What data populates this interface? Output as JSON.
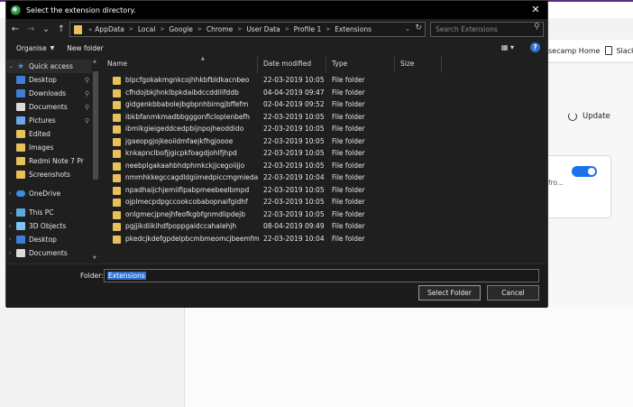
{
  "background": {
    "bookmarks": [
      {
        "label": "secamp Home"
      },
      {
        "label": "Slackb"
      }
    ],
    "update_label": "Update",
    "card_text": "fro...",
    "colors": {
      "accent": "#1a73e8",
      "window_edge": "#5a2d82"
    }
  },
  "dialog": {
    "title": "Select the extension directory.",
    "close_glyph": "✕",
    "nav": {
      "back": "←",
      "forward": "→",
      "recent": "⌄",
      "up": "↑"
    },
    "breadcrumb": [
      "AppData",
      "Local",
      "Google",
      "Chrome",
      "User Data",
      "Profile 1",
      "Extensions"
    ],
    "breadcrumb_prefix": "«",
    "search_placeholder": "Search Extensions",
    "toolbar": {
      "organise": "Organise",
      "new_folder": "New folder",
      "view_icon": "view-options-icon",
      "help": "?"
    },
    "nav_pane": [
      {
        "label": "Quick access",
        "icon": "star-icon",
        "selected": true
      },
      {
        "label": "Desktop",
        "icon": "desktop-icon",
        "pinned": true
      },
      {
        "label": "Downloads",
        "icon": "downloads-icon",
        "pinned": true
      },
      {
        "label": "Documents",
        "icon": "documents-icon",
        "pinned": true
      },
      {
        "label": "Pictures",
        "icon": "pictures-icon",
        "pinned": true
      },
      {
        "label": "Edited",
        "icon": "folder-icon"
      },
      {
        "label": "Images",
        "icon": "folder-icon"
      },
      {
        "label": "Redmi Note 7 Pr",
        "icon": "folder-icon"
      },
      {
        "label": "Screenshots",
        "icon": "folder-icon"
      },
      {
        "label": "OneDrive",
        "icon": "onedrive-icon"
      },
      {
        "label": "This PC",
        "icon": "pc-icon"
      },
      {
        "label": "3D Objects",
        "icon": "3d-objects-icon"
      },
      {
        "label": "Desktop",
        "icon": "desktop-icon"
      },
      {
        "label": "Documents",
        "icon": "documents-icon"
      }
    ],
    "columns": [
      "Name",
      "Date modified",
      "Type",
      "Size"
    ],
    "files": [
      {
        "name": "blpcfgokakmgnkcojhhkbfbldkacnbeo",
        "date": "22-03-2019 10:05",
        "type": "File folder"
      },
      {
        "name": "cfhdojbkjhnklbpkdaibdccddilifddb",
        "date": "04-04-2019 09:47",
        "type": "File folder"
      },
      {
        "name": "gidgenkbbabolejbgbpnhbimgjbffefm",
        "date": "02-04-2019 09:52",
        "type": "File folder"
      },
      {
        "name": "ibkbfanmkmadbbgggonficloplenbefh",
        "date": "22-03-2019 10:05",
        "type": "File folder"
      },
      {
        "name": "ibmlkgieigeddcedpbijnpojheoddido",
        "date": "22-03-2019 10:05",
        "type": "File folder"
      },
      {
        "name": "jgaeopgjojkeoiidmfaejkfhgjoooe",
        "date": "22-03-2019 10:05",
        "type": "File folder"
      },
      {
        "name": "knkapnclbofjjgicpkfoagdjohlfjhpd",
        "date": "22-03-2019 10:05",
        "type": "File folder"
      },
      {
        "name": "neebplgakaahbhdphmkckjjcegoiijjo",
        "date": "22-03-2019 10:05",
        "type": "File folder"
      },
      {
        "name": "nmmhkkegccagdldgiimedpiccmgmieda",
        "date": "22-03-2019 10:04",
        "type": "File folder"
      },
      {
        "name": "npadhaijchjemiifipabpmeebeelbmpd",
        "date": "22-03-2019 10:05",
        "type": "File folder"
      },
      {
        "name": "ojplmecpdpgccookcobabopnaifgidhf",
        "date": "22-03-2019 10:05",
        "type": "File folder"
      },
      {
        "name": "onlgmecjpnejhfeofkgbfgnmdlipdejb",
        "date": "22-03-2019 10:05",
        "type": "File folder"
      },
      {
        "name": "pgjjikdiikihdfpoppgaidccahalehjh",
        "date": "08-04-2019 09:49",
        "type": "File folder"
      },
      {
        "name": "pkedcjkdefgpdelpbcmbmeomcjbeemfm",
        "date": "22-03-2019 10:04",
        "type": "File folder"
      }
    ],
    "folder_label": "Folder:",
    "folder_value": "Extensions",
    "buttons": {
      "select": "Select Folder",
      "cancel": "Cancel"
    },
    "colors": {
      "background": "#1f1f1f",
      "folder": "#e8c15a",
      "selection": "#2f6fd1"
    }
  }
}
